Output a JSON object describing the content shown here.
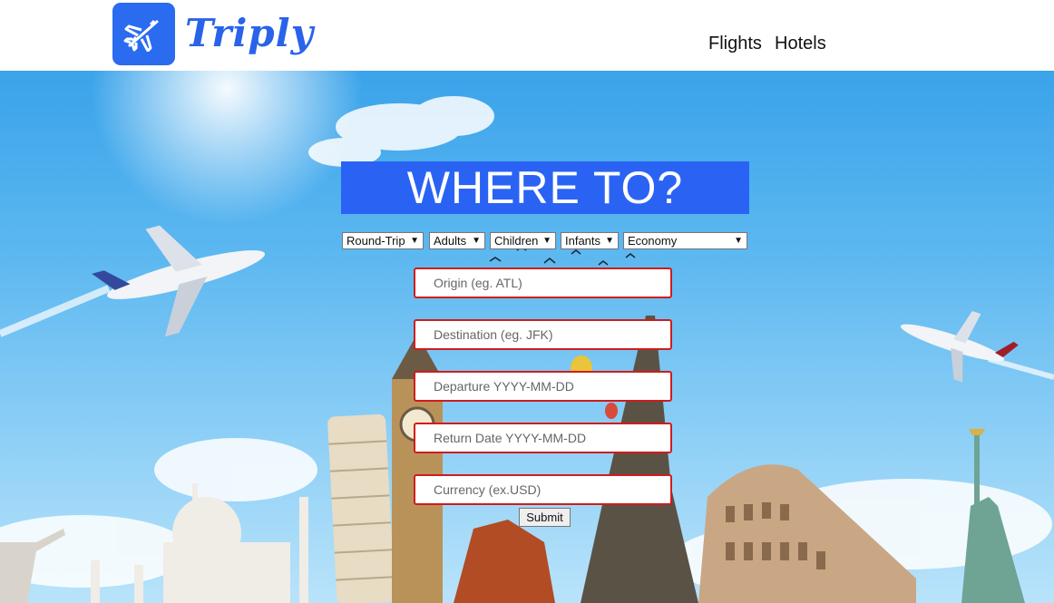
{
  "brand": {
    "name": "Triply",
    "logo_icon": "airplane-icon",
    "accent": "#2a63f4"
  },
  "nav": {
    "flights": "Flights",
    "hotels": "Hotels"
  },
  "hero": {
    "heading": "WHERE TO?"
  },
  "options": {
    "trip_type": "Round-Trip",
    "adults": "Adults",
    "children": "Children",
    "infants": "Infants",
    "cabin": "Economy"
  },
  "form": {
    "origin_placeholder": "Origin (eg. ATL)",
    "destination_placeholder": "Destination (eg. JFK)",
    "departure_placeholder": "Departure YYYY-MM-DD",
    "return_placeholder": "Return Date YYYY-MM-DD",
    "currency_placeholder": "Currency (ex.USD)",
    "submit_label": "Submit"
  },
  "colors": {
    "field_border": "#d01c1c",
    "logo_tile": "#2a6bf0"
  }
}
